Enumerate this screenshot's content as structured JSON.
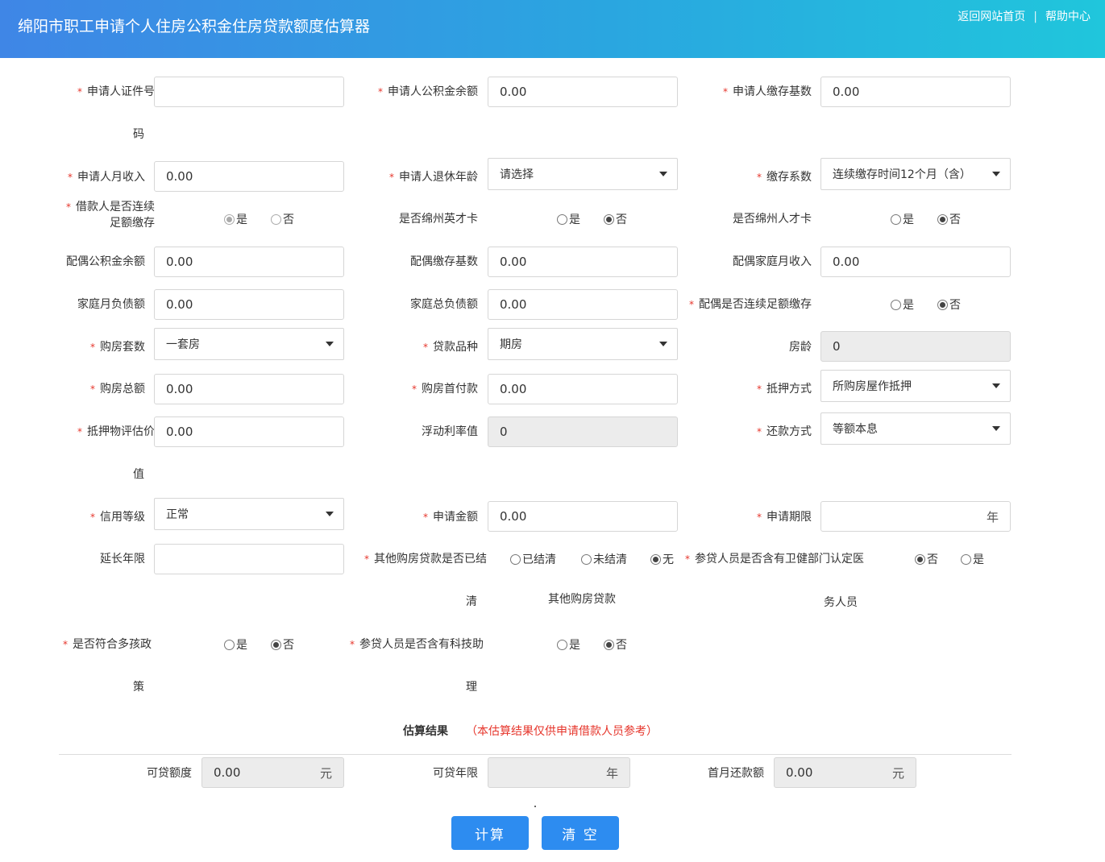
{
  "header": {
    "title": "绵阳市职工申请个人住房公积金住房贷款额度估算器",
    "link_home": "返回网站首页",
    "separator": "|",
    "link_help": "帮助中心"
  },
  "required_mark": "*",
  "fields": {
    "id_no": {
      "label": "申请人证件号",
      "wrap": "码",
      "value": ""
    },
    "fund_balance": {
      "label": "申请人公积金余额",
      "value": "0.00"
    },
    "deposit_base": {
      "label": "申请人缴存基数",
      "value": "0.00"
    },
    "monthly_income": {
      "label": "申请人月收入",
      "value": "0.00"
    },
    "retire_age": {
      "label": "申请人退休年龄",
      "value": "请选择"
    },
    "deposit_coef": {
      "label": "缴存系数",
      "value": "连续缴存时间12个月（含）"
    },
    "borrower_continuous": {
      "label_line1": "借款人是否连续",
      "label_line2": "足额缴存",
      "opt_yes": "是",
      "opt_no": "否"
    },
    "ying_card": {
      "label": "是否绵州英才卡",
      "opt_yes": "是",
      "opt_no": "否"
    },
    "talent_card": {
      "label": "是否绵州人才卡",
      "opt_yes": "是",
      "opt_no": "否"
    },
    "spouse_balance": {
      "label": "配偶公积金余额",
      "value": "0.00"
    },
    "spouse_base": {
      "label": "配偶缴存基数",
      "value": "0.00"
    },
    "family_income": {
      "label": "配偶家庭月收入",
      "value": "0.00"
    },
    "family_monthly_debt": {
      "label": "家庭月负债额",
      "value": "0.00"
    },
    "family_total_debt": {
      "label": "家庭总负债额",
      "value": "0.00"
    },
    "spouse_continuous": {
      "label": "配偶是否连续足额缴存",
      "opt_yes": "是",
      "opt_no": "否"
    },
    "house_count": {
      "label": "购房套数",
      "value": "一套房"
    },
    "loan_type": {
      "label": "贷款品种",
      "value": "期房"
    },
    "house_age": {
      "label": "房龄",
      "value": "0"
    },
    "total_price": {
      "label": "购房总额",
      "value": "0.00"
    },
    "down_payment": {
      "label": "购房首付款",
      "value": "0.00"
    },
    "mortgage_method": {
      "label": "抵押方式",
      "value": "所购房屋作抵押"
    },
    "collateral_value": {
      "label": "抵押物评估价",
      "wrap": "值",
      "value": "0.00"
    },
    "float_rate": {
      "label": "浮动利率值",
      "value": "0"
    },
    "repay_method": {
      "label": "还款方式",
      "value": "等额本息"
    },
    "credit_level": {
      "label": "信用等级",
      "value": "正常"
    },
    "apply_amount": {
      "label": "申请金额",
      "value": "0.00"
    },
    "apply_term": {
      "label": "申请期限",
      "value": "",
      "unit": "年"
    },
    "extend_years": {
      "label": "延长年限",
      "value": ""
    },
    "other_loan": {
      "label": "其他购房贷款是否已结",
      "wrap": "清",
      "opt_settled": "已结清",
      "opt_unsettled": "未结清",
      "opt_none": "无",
      "note": "其他购房贷款"
    },
    "health_staff": {
      "label": "参贷人员是否含有卫健部门认定医",
      "wrap": "务人员",
      "opt_no": "否",
      "opt_yes": "是"
    },
    "multi_child": {
      "label": "是否符合多孩政",
      "wrap": "策",
      "opt_yes": "是",
      "opt_no": "否"
    },
    "tech_assist": {
      "label": "参贷人员是否含有科技助",
      "wrap": "理",
      "opt_yes": "是",
      "opt_no": "否"
    }
  },
  "result": {
    "title": "估算结果",
    "note": "（本估算结果仅供申请借款人员参考）",
    "loan_amount": {
      "label": "可贷额度",
      "value": "0.00",
      "unit": "元"
    },
    "loan_years": {
      "label": "可贷年限",
      "value": "",
      "unit": "年"
    },
    "first_payment": {
      "label": "首月还款额",
      "value": "0.00",
      "unit": "元"
    }
  },
  "buttons": {
    "calculate": "计算",
    "clear": "清 空"
  }
}
